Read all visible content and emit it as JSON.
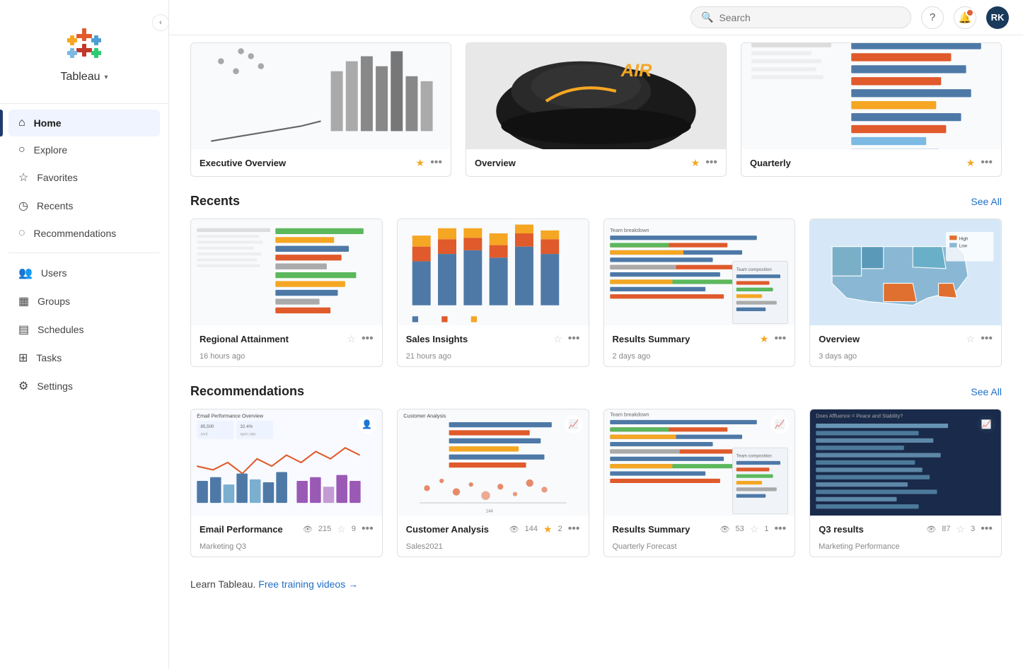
{
  "sidebar": {
    "logo_label": "Tableau",
    "chevron": "▾",
    "collapse_icon": "‹",
    "nav_items": [
      {
        "id": "home",
        "label": "Home",
        "icon": "⌂",
        "active": true
      },
      {
        "id": "explore",
        "label": "Explore",
        "icon": "○",
        "active": false
      },
      {
        "id": "favorites",
        "label": "Favorites",
        "icon": "☆",
        "active": false
      },
      {
        "id": "recents",
        "label": "Recents",
        "icon": "◷",
        "active": false
      },
      {
        "id": "recommendations",
        "label": "Recommendations",
        "icon": "◌",
        "active": false
      }
    ],
    "admin_items": [
      {
        "id": "users",
        "label": "Users",
        "icon": "👥",
        "active": false
      },
      {
        "id": "groups",
        "label": "Groups",
        "icon": "▦",
        "active": false
      },
      {
        "id": "schedules",
        "label": "Schedules",
        "icon": "▤",
        "active": false
      },
      {
        "id": "tasks",
        "label": "Tasks",
        "icon": "⊞",
        "active": false
      },
      {
        "id": "settings",
        "label": "Settings",
        "icon": "⚙",
        "active": false
      }
    ]
  },
  "header": {
    "search_placeholder": "Search",
    "help_icon": "?",
    "notification_icon": "🔔",
    "avatar_label": "RK"
  },
  "top_section": {
    "cards": [
      {
        "title": "Executive Overview",
        "starred": true
      },
      {
        "title": "Overview",
        "starred": true
      },
      {
        "title": "Quarterly",
        "starred": true
      }
    ]
  },
  "recents": {
    "section_title": "Recents",
    "see_all_label": "See All",
    "cards": [
      {
        "title": "Regional Attainment",
        "starred": false,
        "time_ago": "16 hours ago"
      },
      {
        "title": "Sales Insights",
        "starred": false,
        "time_ago": "21 hours ago"
      },
      {
        "title": "Results Summary",
        "starred": true,
        "time_ago": "2 days ago"
      },
      {
        "title": "Overview",
        "starred": false,
        "time_ago": "3 days ago"
      }
    ]
  },
  "recommendations": {
    "section_title": "Recommendations",
    "see_all_label": "See All",
    "cards": [
      {
        "title": "Email Performance",
        "subtitle": "Marketing Q3",
        "views": 215,
        "stars": 9,
        "badge": "👤"
      },
      {
        "title": "Customer Analysis",
        "subtitle": "Sales2021",
        "views": 144,
        "stars": 2,
        "badge": "📈"
      },
      {
        "title": "Results Summary",
        "subtitle": "Quarterly Forecast",
        "views": 53,
        "stars": 1,
        "badge": "📈"
      },
      {
        "title": "Q3 results",
        "subtitle": "Marketing Performance",
        "views": 87,
        "stars": 3,
        "badge": "📈"
      }
    ]
  },
  "learn": {
    "prefix": "Learn Tableau.",
    "link_label": "Free training videos",
    "arrow": "→"
  }
}
